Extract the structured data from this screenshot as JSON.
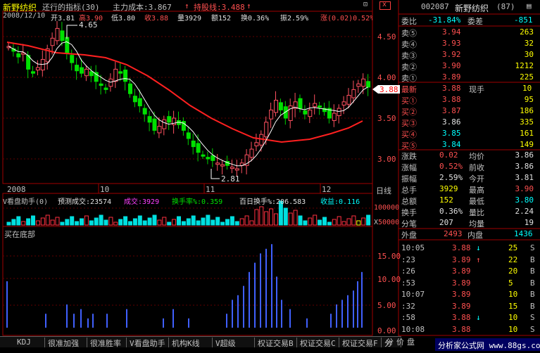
{
  "header": {
    "stock_name": "新野纺织",
    "indicator_label": "还行的指标(30)",
    "cost_label": "主力成本:3.867",
    "cost_arrow": "↑",
    "attack_label": "持股线:3.488",
    "attack_arrow": "↑"
  },
  "info_line": {
    "date": "2008/12/10",
    "open": "开3.81",
    "high": "高3.90",
    "low": "低3.80",
    "close": "收3.88",
    "volume": "量3929",
    "amount": "额152",
    "turnover": "换0.36%",
    "amplitude": "振2.59%",
    "change": "涨(0.02)0.52%"
  },
  "price_axis": [
    "4.50",
    "4.00",
    "3.50",
    "3.00"
  ],
  "current_price_tag": "3.88",
  "high_marker": "4.65",
  "low_marker": "2.81",
  "date_axis": [
    "2008",
    "10",
    "11",
    "12"
  ],
  "period_label": "日线",
  "volume_panel": {
    "label": "V看盘助手(0)",
    "forecast": "预测成交:23574",
    "done": "成交:3929",
    "turnover_rate": "换手率%:0.359",
    "turnover_100": "百日换手%:206.583",
    "yield": "收益:0.116",
    "axis_labels": [
      "100000",
      "50000"
    ],
    "axis_unit": "X"
  },
  "bottom_panel": {
    "label": "买在底部",
    "axis_labels": [
      "15.00",
      "10.00",
      "5.00",
      "0.00"
    ]
  },
  "tabs": [
    "KDJ",
    "很准加强",
    "很准胜率",
    "V看盘助手",
    "机构K线(修",
    "V超级MACD",
    "权证交易B",
    "权证交易C",
    "权证交易F",
    "分隔"
  ],
  "right_panel": {
    "code": "002087",
    "name": "新野纺织",
    "count": "(87)",
    "weibi_label": "委比",
    "weibi_value": "-31.84%",
    "weicha_label": "委差",
    "weicha_value": "-851",
    "sell": [
      {
        "label": "卖⑤",
        "price": "3.94",
        "vol": "263"
      },
      {
        "label": "卖④",
        "price": "3.93",
        "vol": "32"
      },
      {
        "label": "卖③",
        "price": "3.92",
        "vol": "30"
      },
      {
        "label": "卖②",
        "price": "3.90",
        "vol": "1212"
      },
      {
        "label": "卖①",
        "price": "3.89",
        "vol": "225"
      }
    ],
    "latest_label": "最新",
    "latest_value": "3.88",
    "xianshou_label": "现手",
    "xianshou_value": "10",
    "buy": [
      {
        "label": "买①",
        "price": "3.88",
        "vol": "95"
      },
      {
        "label": "买②",
        "price": "3.87",
        "vol": "186"
      },
      {
        "label": "买③",
        "price": "3.86",
        "vol": "335"
      },
      {
        "label": "买④",
        "price": "3.85",
        "vol": "161"
      },
      {
        "label": "买⑤",
        "price": "3.84",
        "vol": "149"
      }
    ],
    "stats": [
      {
        "l1": "涨跌",
        "v1": "0.02",
        "l2": "均价",
        "v2": "3.86"
      },
      {
        "l1": "涨幅",
        "v1": "0.52%",
        "l2": "前收",
        "v2": "3.86"
      },
      {
        "l1": "振幅",
        "v1": "2.59%",
        "l2": "今开",
        "v2": "3.81"
      },
      {
        "l1": "总手",
        "v1": "3929",
        "l2": "最高",
        "v2": "3.90"
      },
      {
        "l1": "总额",
        "v1": "152",
        "l2": "最低",
        "v2": "3.80"
      },
      {
        "l1": "换手",
        "v1": "0.36%",
        "l2": "量比",
        "v2": "2.24"
      },
      {
        "l1": "分笔",
        "v1": "207",
        "l2": "均量",
        "v2": "19"
      }
    ],
    "outer_label": "外盘",
    "outer_value": "2493",
    "inner_label": "内盘",
    "inner_value": "1436",
    "ticks": [
      {
        "time": "10:05",
        "price": "3.88",
        "arrow": "↓",
        "vol": "25",
        "side": "S"
      },
      {
        "time": ":23",
        "price": "3.89",
        "arrow": "↑",
        "vol": "22",
        "side": "B"
      },
      {
        "time": ":26",
        "price": "3.89",
        "arrow": "",
        "vol": "20",
        "side": "B"
      },
      {
        "time": ":53",
        "price": "3.89",
        "arrow": "",
        "vol": "5",
        "side": "B"
      },
      {
        "time": "10:07",
        "price": "3.89",
        "arrow": "",
        "vol": "10",
        "side": "B"
      },
      {
        "time": ":32",
        "price": "3.89",
        "arrow": "",
        "vol": "15",
        "side": "B"
      },
      {
        "time": ":58",
        "price": "3.88",
        "arrow": "↓",
        "vol": "10",
        "side": "S"
      },
      {
        "time": "10:08",
        "price": "3.88",
        "arrow": "",
        "vol": "10",
        "side": "S"
      }
    ],
    "bottom_tabs": [
      "分",
      "价",
      "盘"
    ]
  },
  "watermark": "分析家公式网 www.88gs.com",
  "colors": {
    "up": "#ff5050",
    "down": "#00e0e0",
    "ma_red": "#ff2020",
    "ma_white": "#ffffff",
    "grid": "#800000"
  }
}
